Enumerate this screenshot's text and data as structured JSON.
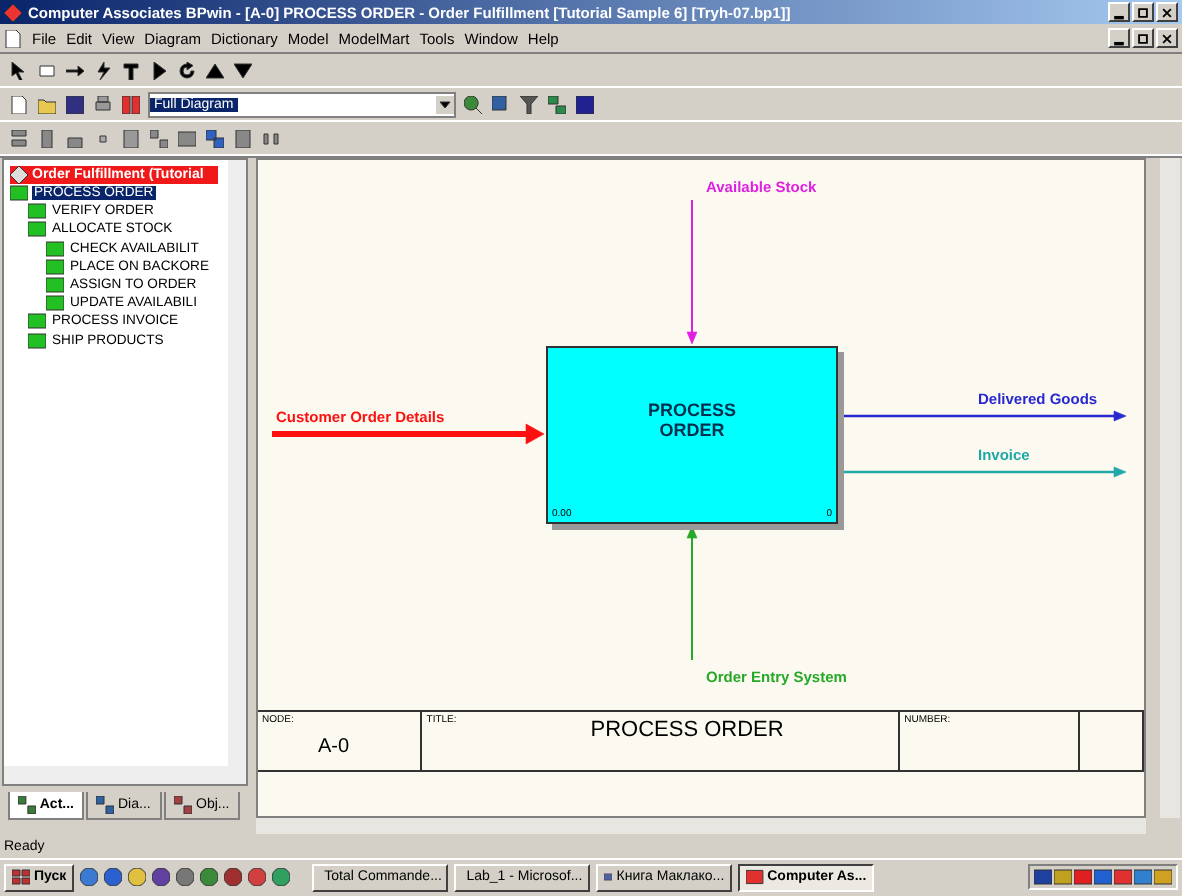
{
  "window": {
    "title": "Computer Associates BPwin - [A-0] PROCESS  ORDER - Order Fulfillment [Tutorial Sample 6]  [Tryh-07.bp1]]"
  },
  "menu": [
    "File",
    "Edit",
    "View",
    "Diagram",
    "Dictionary",
    "Model",
    "ModelMart",
    "Tools",
    "Window",
    "Help"
  ],
  "toolbar": {
    "zoom_select": "Full Diagram"
  },
  "tree": {
    "root": "Order Fulfillment (Tutorial",
    "items": [
      {
        "label": "PROCESS ORDER",
        "selected": true,
        "children": [
          {
            "label": "VERIFY ORDER",
            "selected": false
          },
          {
            "label": "ALLOCATE STOCK",
            "selected": false,
            "children": [
              {
                "label": "CHECK AVAILABILIT",
                "selected": false
              },
              {
                "label": "PLACE ON BACKORE",
                "selected": false
              },
              {
                "label": "ASSIGN TO ORDER",
                "selected": false
              },
              {
                "label": "UPDATE AVAILABILI",
                "selected": false
              }
            ]
          },
          {
            "label": "PROCESS INVOICE",
            "selected": false
          },
          {
            "label": "SHIP PRODUCTS",
            "selected": false
          }
        ]
      }
    ]
  },
  "tree_tabs": [
    {
      "label": "Act...",
      "selected": true
    },
    {
      "label": "Dia...",
      "selected": false
    },
    {
      "label": "Obj...",
      "selected": false
    }
  ],
  "diagram": {
    "activity": {
      "name": "PROCESS ORDER",
      "cost": "0.00",
      "number": "0"
    },
    "arrows": [
      {
        "kind": "control",
        "label": "Available Stock",
        "color": "#e020e0"
      },
      {
        "kind": "input",
        "label": "Customer Order Details",
        "color": "#ff1010"
      },
      {
        "kind": "output",
        "label": "Delivered Goods",
        "color": "#2828d0"
      },
      {
        "kind": "output",
        "label": "Invoice",
        "color": "#20a8a8"
      },
      {
        "kind": "mechanism",
        "label": "Order Entry System",
        "color": "#28a828"
      }
    ],
    "footer": {
      "node_label": "NODE:",
      "node": "A-0",
      "title_label": "TITLE:",
      "title": "PROCESS ORDER",
      "number_label": "NUMBER:"
    }
  },
  "status_bar": "Ready",
  "taskbar": {
    "start": "Пуск",
    "tasks": [
      {
        "label": "Total Commande...",
        "selected": false
      },
      {
        "label": "Lab_1 - Microsof...",
        "selected": false
      },
      {
        "label": "Книга Маклако...",
        "selected": false
      },
      {
        "label": "Computer As...",
        "selected": true
      }
    ]
  }
}
